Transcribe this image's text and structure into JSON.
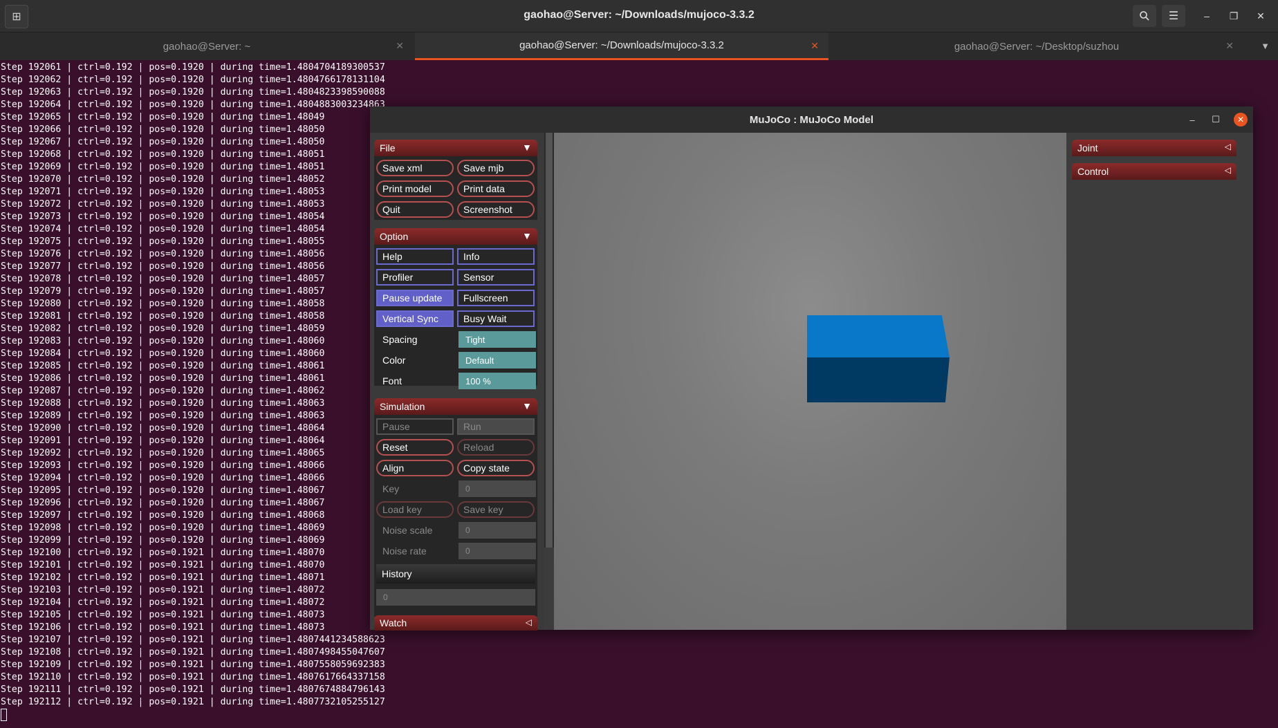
{
  "window": {
    "title": "gaohao@Server: ~/Downloads/mujoco-3.3.2"
  },
  "tabs": [
    {
      "label": "gaohao@Server: ~",
      "active": false
    },
    {
      "label": "gaohao@Server: ~/Downloads/mujoco-3.3.2",
      "active": true
    },
    {
      "label": "gaohao@Server: ~/Desktop/suzhou",
      "active": false
    }
  ],
  "terminal": {
    "lines": [
      "Step 192061 | ctrl=0.192 | pos=0.1920 | during time=1.4804704189300537",
      "Step 192062 | ctrl=0.192 | pos=0.1920 | during time=1.4804766178131104",
      "Step 192063 | ctrl=0.192 | pos=0.1920 | during time=1.4804823398590088",
      "Step 192064 | ctrl=0.192 | pos=0.1920 | during time=1.4804883003234863",
      "Step 192065 | ctrl=0.192 | pos=0.1920 | during time=1.48049",
      "Step 192066 | ctrl=0.192 | pos=0.1920 | during time=1.48050",
      "Step 192067 | ctrl=0.192 | pos=0.1920 | during time=1.48050",
      "Step 192068 | ctrl=0.192 | pos=0.1920 | during time=1.48051",
      "Step 192069 | ctrl=0.192 | pos=0.1920 | during time=1.48051",
      "Step 192070 | ctrl=0.192 | pos=0.1920 | during time=1.48052",
      "Step 192071 | ctrl=0.192 | pos=0.1920 | during time=1.48053",
      "Step 192072 | ctrl=0.192 | pos=0.1920 | during time=1.48053",
      "Step 192073 | ctrl=0.192 | pos=0.1920 | during time=1.48054",
      "Step 192074 | ctrl=0.192 | pos=0.1920 | during time=1.48054",
      "Step 192075 | ctrl=0.192 | pos=0.1920 | during time=1.48055",
      "Step 192076 | ctrl=0.192 | pos=0.1920 | during time=1.48056",
      "Step 192077 | ctrl=0.192 | pos=0.1920 | during time=1.48056",
      "Step 192078 | ctrl=0.192 | pos=0.1920 | during time=1.48057",
      "Step 192079 | ctrl=0.192 | pos=0.1920 | during time=1.48057",
      "Step 192080 | ctrl=0.192 | pos=0.1920 | during time=1.48058",
      "Step 192081 | ctrl=0.192 | pos=0.1920 | during time=1.48058",
      "Step 192082 | ctrl=0.192 | pos=0.1920 | during time=1.48059",
      "Step 192083 | ctrl=0.192 | pos=0.1920 | during time=1.48060",
      "Step 192084 | ctrl=0.192 | pos=0.1920 | during time=1.48060",
      "Step 192085 | ctrl=0.192 | pos=0.1920 | during time=1.48061",
      "Step 192086 | ctrl=0.192 | pos=0.1920 | during time=1.48061",
      "Step 192087 | ctrl=0.192 | pos=0.1920 | during time=1.48062",
      "Step 192088 | ctrl=0.192 | pos=0.1920 | during time=1.48063",
      "Step 192089 | ctrl=0.192 | pos=0.1920 | during time=1.48063",
      "Step 192090 | ctrl=0.192 | pos=0.1920 | during time=1.48064",
      "Step 192091 | ctrl=0.192 | pos=0.1920 | during time=1.48064",
      "Step 192092 | ctrl=0.192 | pos=0.1920 | during time=1.48065",
      "Step 192093 | ctrl=0.192 | pos=0.1920 | during time=1.48066",
      "Step 192094 | ctrl=0.192 | pos=0.1920 | during time=1.48066",
      "Step 192095 | ctrl=0.192 | pos=0.1920 | during time=1.48067",
      "Step 192096 | ctrl=0.192 | pos=0.1920 | during time=1.48067",
      "Step 192097 | ctrl=0.192 | pos=0.1920 | during time=1.48068",
      "Step 192098 | ctrl=0.192 | pos=0.1920 | during time=1.48069",
      "Step 192099 | ctrl=0.192 | pos=0.1920 | during time=1.48069",
      "Step 192100 | ctrl=0.192 | pos=0.1921 | during time=1.48070",
      "Step 192101 | ctrl=0.192 | pos=0.1921 | during time=1.48070",
      "Step 192102 | ctrl=0.192 | pos=0.1921 | during time=1.48071",
      "Step 192103 | ctrl=0.192 | pos=0.1921 | during time=1.48072",
      "Step 192104 | ctrl=0.192 | pos=0.1921 | during time=1.48072",
      "Step 192105 | ctrl=0.192 | pos=0.1921 | during time=1.48073",
      "Step 192106 | ctrl=0.192 | pos=0.1921 | during time=1.48073",
      "Step 192107 | ctrl=0.192 | pos=0.1921 | during time=1.4807441234588623",
      "Step 192108 | ctrl=0.192 | pos=0.1921 | during time=1.4807498455047607",
      "Step 192109 | ctrl=0.192 | pos=0.1921 | during time=1.4807558059692383",
      "Step 192110 | ctrl=0.192 | pos=0.1921 | during time=1.4807617664337158",
      "Step 192111 | ctrl=0.192 | pos=0.1921 | during time=1.4807674884796143",
      "Step 192112 | ctrl=0.192 | pos=0.1921 | during time=1.4807732105255127"
    ]
  },
  "mujoco": {
    "title": "MuJoCo : MuJoCo Model",
    "file": {
      "header": "File",
      "save_xml": "Save xml",
      "save_mjb": "Save mjb",
      "print_model": "Print model",
      "print_data": "Print data",
      "quit": "Quit",
      "screenshot": "Screenshot"
    },
    "option": {
      "header": "Option",
      "help": "Help",
      "info": "Info",
      "profiler": "Profiler",
      "sensor": "Sensor",
      "pause_update": "Pause update",
      "fullscreen": "Fullscreen",
      "vertical_sync": "Vertical Sync",
      "busy_wait": "Busy Wait",
      "spacing_label": "Spacing",
      "spacing_value": "Tight",
      "color_label": "Color",
      "color_value": "Default",
      "font_label": "Font",
      "font_value": "100 %"
    },
    "simulation": {
      "header": "Simulation",
      "pause": "Pause",
      "run": "Run",
      "reset": "Reset",
      "reload": "Reload",
      "align": "Align",
      "copy_state": "Copy state",
      "key_label": "Key",
      "key_value": "0",
      "load_key": "Load key",
      "save_key": "Save key",
      "noise_scale_label": "Noise scale",
      "noise_scale_value": "0",
      "noise_rate_label": "Noise rate",
      "noise_rate_value": "0",
      "history_label": "History",
      "history_value": "0"
    },
    "watch": {
      "header": "Watch"
    },
    "right": {
      "joint": "Joint",
      "control": "Control"
    },
    "colors": {
      "box_top": "#0a78c8",
      "box_front": "#003a62",
      "box_side": "#05508a"
    }
  }
}
